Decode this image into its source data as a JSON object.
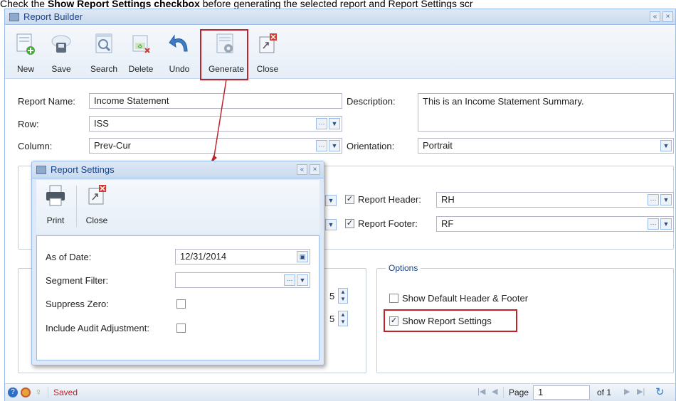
{
  "caption": {
    "prefix": "Check the ",
    "bold": "Show Report Settings checkbox",
    "suffix": " before generating the selected report and Report Settings scr"
  },
  "window": {
    "title": "Report Builder",
    "title_buttons": [
      "«",
      "×"
    ]
  },
  "toolbar": {
    "buttons": [
      {
        "label": "New",
        "icon": "new-doc-icon"
      },
      {
        "label": "Save",
        "icon": "save-cloud-icon"
      },
      {
        "label": "Search",
        "icon": "search-doc-icon"
      },
      {
        "label": "Delete",
        "icon": "delete-doc-icon"
      },
      {
        "label": "Undo",
        "icon": "undo-arrow-icon"
      },
      {
        "label": "Generate",
        "icon": "generate-gear-icon"
      },
      {
        "label": "Close",
        "icon": "close-window-icon"
      }
    ]
  },
  "form": {
    "report_name_label": "Report Name:",
    "report_name_value": "Income Statement",
    "row_label": "Row:",
    "row_value": "ISS",
    "column_label": "Column:",
    "column_value": "Prev-Cur",
    "description_label": "Description:",
    "description_value": "This is an Income Statement Summary.",
    "orientation_label": "Orientation:",
    "orientation_value": "Portrait",
    "report_header_label": "Report Header:",
    "report_header_value": "RH",
    "report_footer_label": "Report Footer:",
    "report_footer_value": "RF",
    "spin1_value": "5",
    "spin2_value": "5"
  },
  "options": {
    "legend": "Options",
    "show_default_header_footer": "Show Default Header & Footer",
    "show_report_settings": "Show Report Settings"
  },
  "statusbar": {
    "status_text": "Saved",
    "page_label": "Page",
    "page_value": "1",
    "of_label": "of 1"
  },
  "dialog": {
    "title": "Report Settings",
    "buttons": [
      {
        "label": "Print",
        "icon": "printer-icon"
      },
      {
        "label": "Close",
        "icon": "close-window-icon"
      }
    ],
    "as_of_date_label": "As of Date:",
    "as_of_date_value": "12/31/2014",
    "segment_filter_label": "Segment Filter:",
    "segment_filter_value": "",
    "suppress_zero_label": "Suppress Zero:",
    "include_audit_label": "Include Audit Adjustment:"
  },
  "colors": {
    "accent": "#15428b",
    "border": "#99bbe8",
    "highlight": "#c0242a",
    "status_text": "#c0242a"
  }
}
